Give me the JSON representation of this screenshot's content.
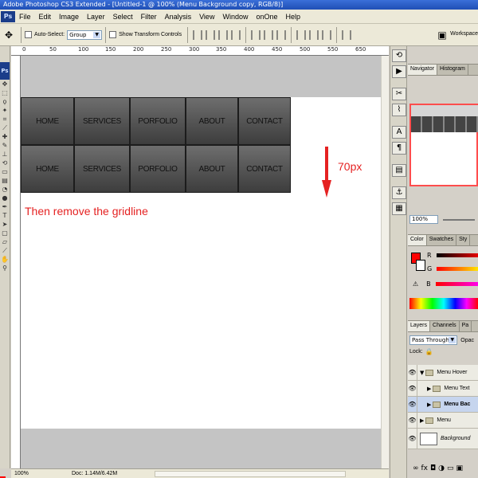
{
  "window": {
    "title": "Adobe Photoshop CS3 Extended - [Untitled-1 @ 100% (Menu Background copy, RGB/8)]"
  },
  "menubar": {
    "app_badge": "Ps",
    "items": [
      "File",
      "Edit",
      "Image",
      "Layer",
      "Select",
      "Filter",
      "Analysis",
      "View",
      "Window",
      "onOne",
      "Help"
    ]
  },
  "options": {
    "auto_select_label": "Auto-Select:",
    "auto_select_value": "Group",
    "show_transform_label": "Show Transform Controls",
    "workspace_label": "Workspace"
  },
  "rulers": {
    "top_numbers": [
      "0",
      "50",
      "100",
      "150",
      "200",
      "250",
      "300",
      "350",
      "400",
      "450",
      "500",
      "550",
      "650"
    ]
  },
  "canvas": {
    "menu_rows": [
      [
        "HOME",
        "SERVICES",
        "PORFOLIO",
        "ABOUT",
        "CONTACT"
      ],
      [
        "HOME",
        "SERVICES",
        "PORFOLIO",
        "ABOUT",
        "CONTACT"
      ]
    ],
    "offset_label": "70px",
    "instruction": "Then remove the gridline",
    "annotation_color": "#e52222",
    "band_color": "#c4c4c4"
  },
  "statusbar": {
    "zoom": "100%",
    "doc_size": "Doc: 1.14M/6.42M"
  },
  "panels": {
    "navigator": {
      "tabs": [
        "Navigator",
        "Histogram"
      ],
      "zoom_value": "100%"
    },
    "color": {
      "tabs": [
        "Color",
        "Swatches",
        "Sty"
      ],
      "channels": [
        "R",
        "G",
        "B"
      ],
      "foreground": "#ff0000"
    },
    "layers": {
      "tabs": [
        "Layers",
        "Channels",
        "Pa"
      ],
      "blend_mode": "Pass Through",
      "opacity_label": "Opac",
      "lock_label": "Lock:",
      "items": [
        {
          "name": "Menu Hover",
          "type": "group",
          "expanded": true
        },
        {
          "name": "Menu Text",
          "type": "group",
          "expanded": false
        },
        {
          "name": "Menu Bac",
          "type": "group",
          "selected": true
        },
        {
          "name": "Menu",
          "type": "group"
        },
        {
          "name": "Background",
          "type": "layer"
        }
      ]
    }
  }
}
